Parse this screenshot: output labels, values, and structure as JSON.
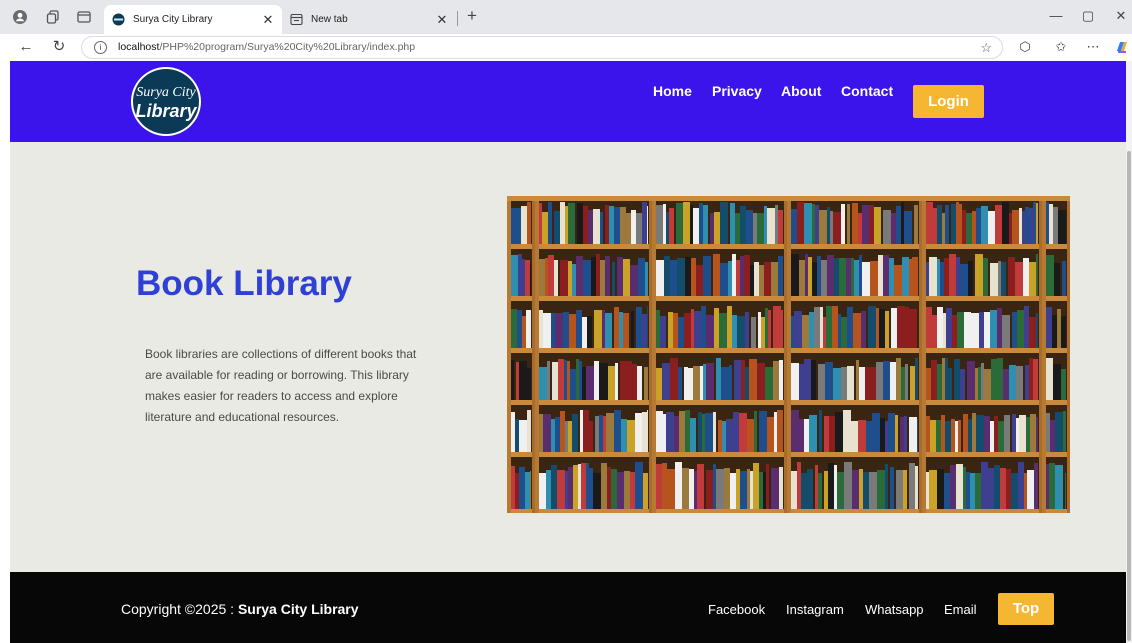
{
  "browser": {
    "tabs": [
      {
        "title": "Surya City Library",
        "active": true
      },
      {
        "title": "New tab",
        "active": false
      }
    ],
    "address": {
      "host": "localhost",
      "path": "/PHP%20program/Surya%20City%20Library/index.php"
    },
    "colors": {
      "tabstrip": "#e6e7ea",
      "toolbar": "#ffffff"
    }
  },
  "site": {
    "logo": {
      "line1": "Surya City",
      "line2": "Library"
    },
    "nav": [
      {
        "label": "Home"
      },
      {
        "label": "Privacy"
      },
      {
        "label": "About"
      },
      {
        "label": "Contact"
      }
    ],
    "login_label": "Login",
    "hero": {
      "title": "Book Library",
      "description": "Book libraries are collections of different books that are available for reading or borrowing. This library makes easier for readers to access and explore literature and educational resources."
    },
    "footer": {
      "copyright_prefix": "Copyright ©2025 : ",
      "copyright_name": "Surya City Library",
      "links": [
        {
          "label": "Facebook"
        },
        {
          "label": "Instagram"
        },
        {
          "label": "Whatsapp"
        },
        {
          "label": "Email"
        }
      ],
      "top_label": "Top"
    },
    "colors": {
      "header": "#3a14ea",
      "accent_button": "#f5b731",
      "title": "#2e40d6",
      "body_bg": "#eaeae4",
      "footer": "#070707"
    }
  }
}
